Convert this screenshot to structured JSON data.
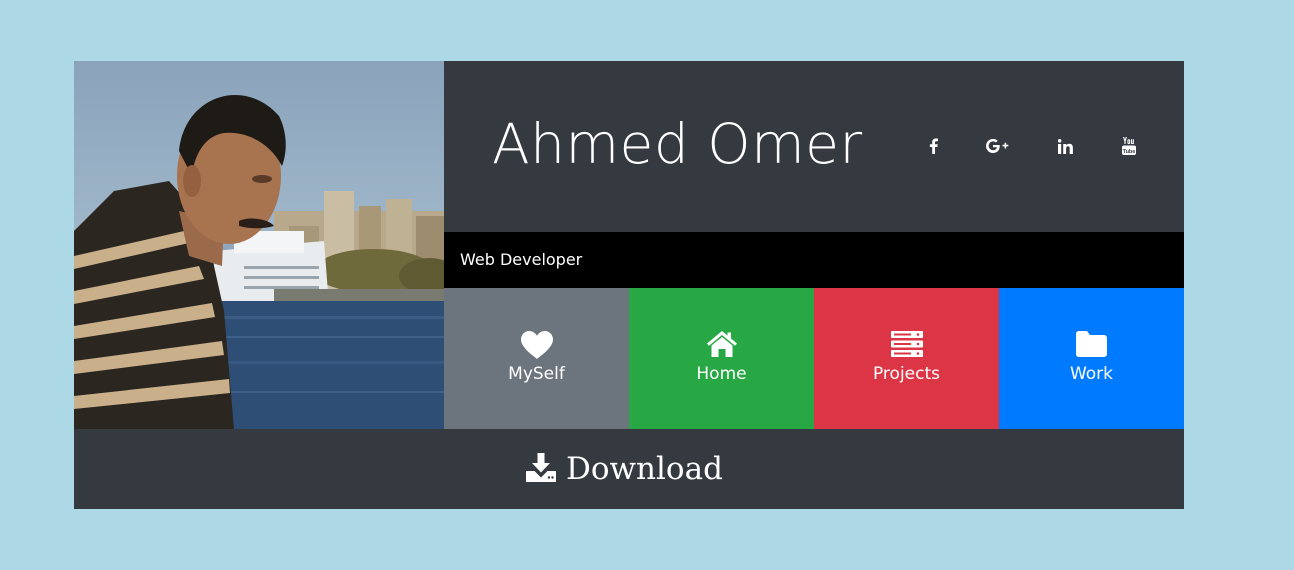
{
  "profile": {
    "name": "Ahmed Omer",
    "title": "Web Developer",
    "photo_icon": "profile-photo"
  },
  "social": [
    {
      "name": "facebook-link",
      "icon": "facebook-icon"
    },
    {
      "name": "google-plus-link",
      "icon": "google-plus-icon"
    },
    {
      "name": "linkedin-link",
      "icon": "linkedin-icon"
    },
    {
      "name": "youtube-link",
      "icon": "youtube-icon"
    }
  ],
  "tiles": [
    {
      "label": "MySelf",
      "icon": "heart-icon",
      "color": "#6c757d"
    },
    {
      "label": "Home",
      "icon": "home-icon",
      "color": "#28a745"
    },
    {
      "label": "Projects",
      "icon": "server-icon",
      "color": "#dc3545"
    },
    {
      "label": "Work",
      "icon": "folder-icon",
      "color": "#007bff"
    }
  ],
  "download": {
    "label": "Download",
    "icon": "download-icon"
  },
  "colors": {
    "page_background": "#add8e6",
    "card_background": "#343a40",
    "subtitle_background": "#000000"
  }
}
